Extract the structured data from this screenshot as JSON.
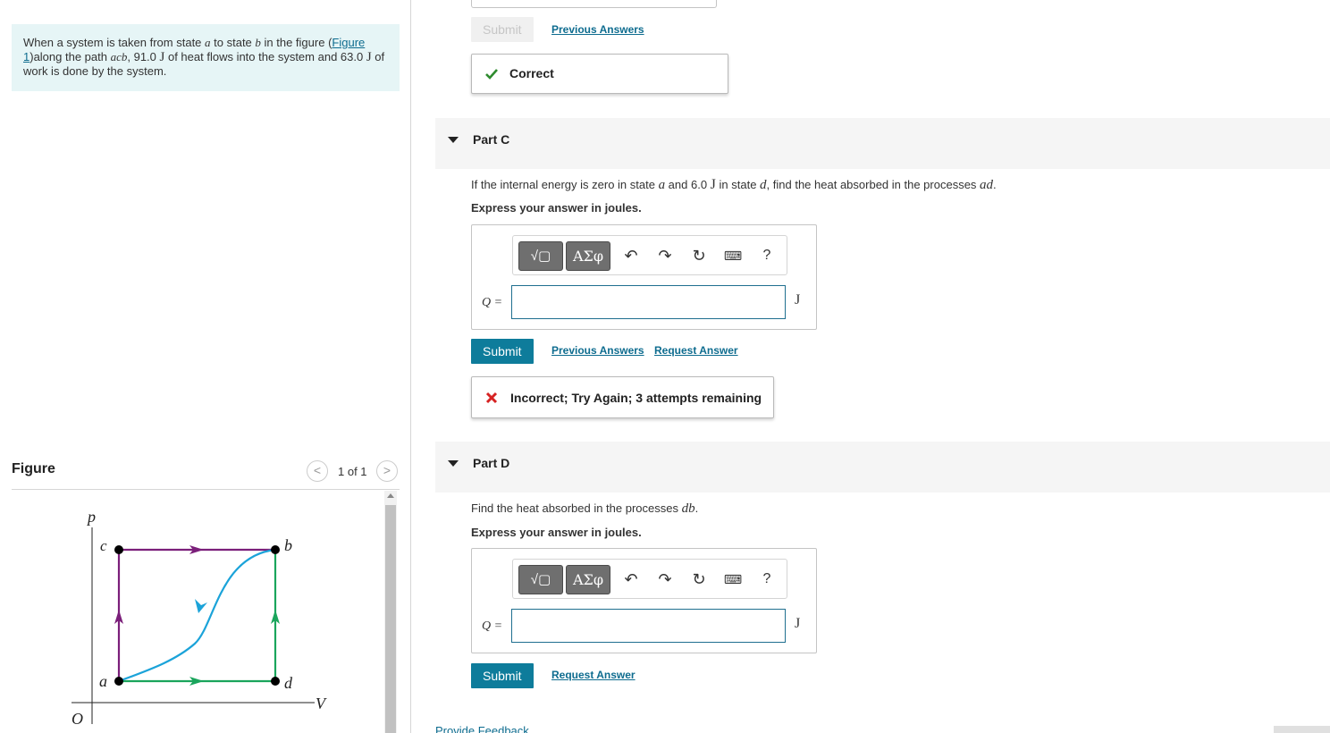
{
  "problem": {
    "text_1": "When a system is taken from state ",
    "var_a": "a",
    "text_2": " to state ",
    "var_b": "b",
    "text_3": " in the figure (",
    "figure_link": "Figure 1",
    "text_4": ")along the path ",
    "var_path": "acb",
    "text_5": ", 91.0 ",
    "unit_j1": "J",
    "text_6": " of heat flows into the system and 63.0 ",
    "unit_j2": "J",
    "text_7": " of work is done by the system."
  },
  "figure_panel": {
    "title": "Figure",
    "pager_prev": "<",
    "pager_count": "1 of 1",
    "pager_next": ">",
    "diagram": {
      "p_axis": "p",
      "v_axis": "V",
      "origin": "O",
      "label_a": "a",
      "label_b": "b",
      "label_c": "c",
      "label_d": "d",
      "colors": {
        "purple": "#7b1f7a",
        "green": "#1aa55c",
        "blue": "#1ba3d9",
        "dot": "#000000"
      }
    }
  },
  "part_b_tail": {
    "submit_label": "Submit",
    "previous_answers": "Previous Answers",
    "feedback": "Correct"
  },
  "part_c": {
    "title": "Part C",
    "q_1": "If the internal energy is zero in state ",
    "q_var_a": "a",
    "q_2": " and 6.0 ",
    "q_unit": "J",
    "q_3": " in state ",
    "q_var_d": "d",
    "q_4": ", find the heat absorbed in the processes ",
    "q_var_ad": "ad",
    "q_5": ".",
    "instruction": "Express your answer in joules.",
    "toolbar": {
      "template_symbol": "√▢",
      "greek_symbol": "ΑΣφ",
      "help": "?"
    },
    "answer_label": "Q =",
    "answer_value": "",
    "unit": "J",
    "submit_label": "Submit",
    "previous_answers": "Previous Answers",
    "request_answer": "Request Answer",
    "feedback": "Incorrect; Try Again; 3 attempts remaining"
  },
  "part_d": {
    "title": "Part D",
    "q_1": "Find the heat absorbed in the processes ",
    "q_var_db": "db",
    "q_2": ".",
    "instruction": "Express your answer in joules.",
    "toolbar": {
      "template_symbol": "√▢",
      "greek_symbol": "ΑΣφ",
      "help": "?"
    },
    "answer_label": "Q =",
    "answer_value": "",
    "unit": "J",
    "submit_label": "Submit",
    "request_answer": "Request Answer"
  },
  "footer": {
    "provide_feedback": "Provide Feedback"
  },
  "colors": {
    "accent": "#0e7c9b",
    "correct": "#2e8b2e",
    "incorrect": "#d62222",
    "problem_bg": "#e6f5f6"
  }
}
